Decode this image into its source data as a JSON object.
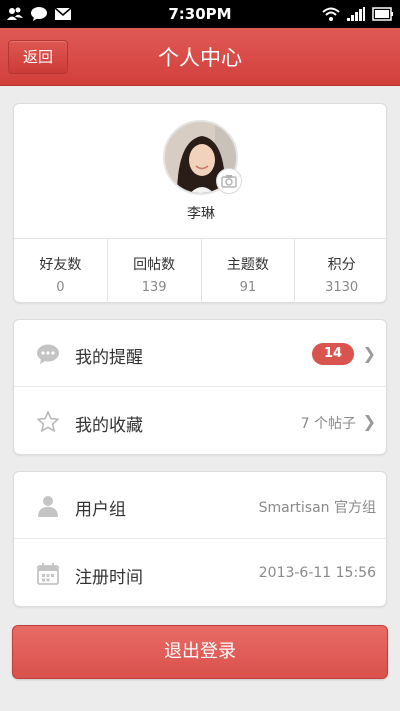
{
  "status_bar": {
    "time": "7:30PM",
    "icons": [
      "contacts-icon",
      "chat-icon",
      "mail-icon",
      "wifi-icon",
      "signal-icon",
      "battery-icon"
    ]
  },
  "header": {
    "back_label": "返回",
    "title": "个人中心"
  },
  "profile": {
    "name": "李琳",
    "stats": [
      {
        "label": "好友数",
        "value": "0"
      },
      {
        "label": "回帖数",
        "value": "139"
      },
      {
        "label": "主题数",
        "value": "91"
      },
      {
        "label": "积分",
        "value": "3130"
      }
    ]
  },
  "menu": {
    "reminders": {
      "label": "我的提醒",
      "badge": "14",
      "icon": "chat-bubble-icon"
    },
    "favorites": {
      "label": "我的收藏",
      "value": "7 个帖子",
      "icon": "star-icon"
    }
  },
  "info": {
    "group": {
      "label": "用户组",
      "value": "Smartisan 官方组",
      "icon": "user-icon"
    },
    "register": {
      "label": "注册时间",
      "value": "2013-6-11 15:56",
      "icon": "calendar-icon"
    }
  },
  "logout_label": "退出登录",
  "colors": {
    "accent": "#d9534f",
    "header": "#d94a46",
    "background": "#ececec"
  }
}
